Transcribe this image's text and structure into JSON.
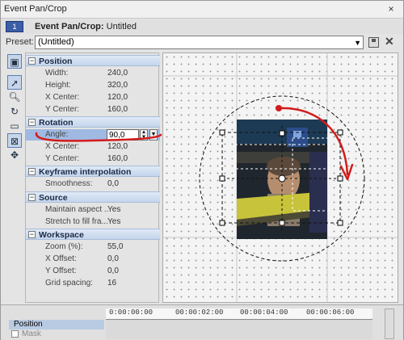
{
  "window": {
    "title": "Event Pan/Crop",
    "close_glyph": "×"
  },
  "event": {
    "number": "1",
    "label": "Event Pan/Crop:",
    "name": "Untitled"
  },
  "preset": {
    "label": "Preset:",
    "value": "(Untitled)"
  },
  "groups": {
    "position": {
      "label": "Position",
      "collapse": "−"
    },
    "rotation": {
      "label": "Rotation",
      "collapse": "−"
    },
    "keyframe": {
      "label": "Keyframe interpolation",
      "collapse": "−"
    },
    "source": {
      "label": "Source",
      "collapse": "−"
    },
    "workspace": {
      "label": "Workspace",
      "collapse": "−"
    }
  },
  "position": [
    {
      "key": "Width:",
      "value": "240,0"
    },
    {
      "key": "Height:",
      "value": "320,0"
    },
    {
      "key": "X Center:",
      "value": "120,0"
    },
    {
      "key": "Y Center:",
      "value": "160,0"
    }
  ],
  "rotation": {
    "angle_label": "Angle:",
    "angle_value": "90,0",
    "rows": [
      {
        "key": "X Center:",
        "value": "120,0"
      },
      {
        "key": "Y Center:",
        "value": "160,0"
      }
    ]
  },
  "keyframe": [
    {
      "key": "Smoothness:",
      "value": "0,0"
    }
  ],
  "source": [
    {
      "key": "Maintain aspect ...",
      "value": "Yes"
    },
    {
      "key": "Stretch to fill fra...",
      "value": "Yes"
    }
  ],
  "workspace": [
    {
      "key": "Zoom (%):",
      "value": "55,0"
    },
    {
      "key": "X Offset:",
      "value": "0,0"
    },
    {
      "key": "Y Offset:",
      "value": "0,0"
    },
    {
      "key": "Grid spacing:",
      "value": "16"
    }
  ],
  "timeline": {
    "track_position": "Position",
    "track_mask": "Mask",
    "ticks": [
      "0:00:00:00",
      "00:00:02:00",
      "00:00:04:00",
      "00:00:06:00"
    ]
  },
  "tools": [
    "normal-edit-tool-icon",
    "arrow-select-icon",
    "zoom-icon",
    "enable-rotation-icon",
    "move-freely-icon",
    "lock-aspect-icon",
    "scale-about-center-icon",
    "move-cross-icon"
  ],
  "colors": {
    "annotation_red": "#d41b1b",
    "highlight_blue": "#9fb9e2",
    "group_header": "#c4d5ec"
  }
}
